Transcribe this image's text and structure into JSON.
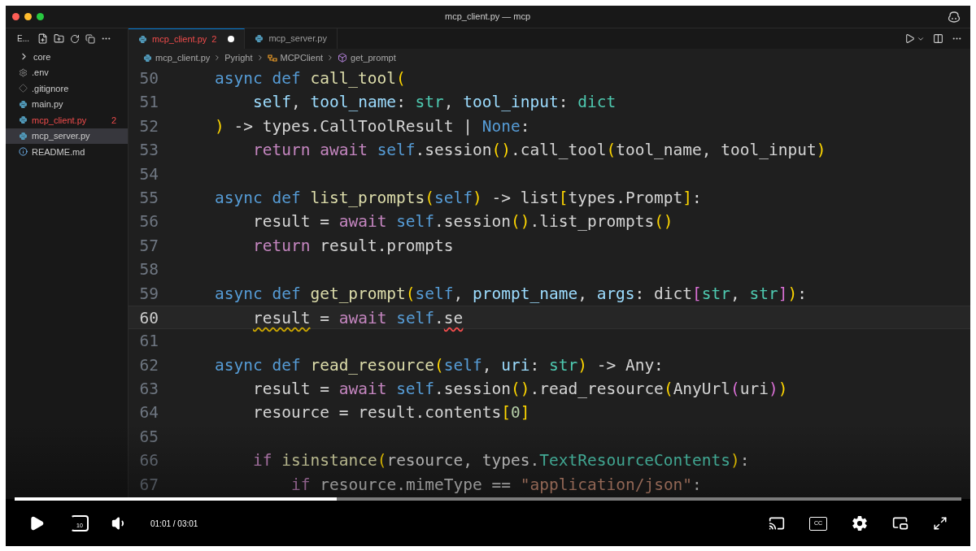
{
  "window": {
    "title": "mcp_client.py — mcp"
  },
  "sidebar": {
    "header": "E...",
    "items": [
      {
        "label": "core",
        "kind": "folder",
        "selected": false,
        "error": false
      },
      {
        "label": ".env",
        "kind": "settings",
        "selected": false,
        "error": false
      },
      {
        "label": ".gitignore",
        "kind": "git",
        "selected": false,
        "error": false
      },
      {
        "label": "main.py",
        "kind": "python",
        "selected": false,
        "error": false
      },
      {
        "label": "mcp_client.py",
        "kind": "python",
        "selected": false,
        "error": true,
        "problems": "2"
      },
      {
        "label": "mcp_server.py",
        "kind": "python",
        "selected": true,
        "error": false
      },
      {
        "label": "README.md",
        "kind": "info",
        "selected": false,
        "error": false
      }
    ]
  },
  "tabs": [
    {
      "label": "mcp_client.py",
      "problems": "2",
      "unsaved": true,
      "error": true,
      "selected": true
    },
    {
      "label": "mcp_server.py",
      "unsaved": false,
      "error": false,
      "selected": false
    }
  ],
  "breadcrumb": [
    {
      "label": "mcp_client.py",
      "kind": "python"
    },
    {
      "label": "Pyright",
      "kind": "plain"
    },
    {
      "label": "MCPClient",
      "kind": "class"
    },
    {
      "label": "get_prompt",
      "kind": "method"
    }
  ],
  "code": [
    {
      "number": "50",
      "current": false,
      "kind": "def",
      "tokens": [
        {
          "text": "async def ",
          "kind": "keyword"
        },
        {
          "text": "call_tool",
          "kind": "function"
        },
        {
          "text": "(",
          "kind": "bracket"
        }
      ]
    },
    {
      "number": "51",
      "current": false,
      "kind": "body",
      "tokens": [
        {
          "text": "self",
          "kind": "param"
        },
        {
          "text": ", ",
          "kind": "plain"
        },
        {
          "text": "tool_name",
          "kind": "param"
        },
        {
          "text": ": ",
          "kind": "plain"
        },
        {
          "text": "str",
          "kind": "type"
        },
        {
          "text": ", ",
          "kind": "plain"
        },
        {
          "text": "tool_input",
          "kind": "param"
        },
        {
          "text": ": ",
          "kind": "plain"
        },
        {
          "text": "dict",
          "kind": "type"
        }
      ]
    },
    {
      "number": "52",
      "current": false,
      "kind": "def",
      "tokens": [
        {
          "text": ")",
          "kind": "bracket"
        },
        {
          "text": " -> types.CallToolResult | ",
          "kind": "plain"
        },
        {
          "text": "None",
          "kind": "keyword"
        },
        {
          "text": ":",
          "kind": "plain"
        }
      ]
    },
    {
      "number": "53",
      "current": false,
      "kind": "body",
      "tokens": [
        {
          "text": "return await ",
          "kind": "control"
        },
        {
          "text": "self",
          "kind": "keyword"
        },
        {
          "text": ".session",
          "kind": "plain"
        },
        {
          "text": "()",
          "kind": "bracket"
        },
        {
          "text": ".call_tool",
          "kind": "plain"
        },
        {
          "text": "(",
          "kind": "bracket"
        },
        {
          "text": "tool_name, tool_input",
          "kind": "plain"
        },
        {
          "text": ")",
          "kind": "bracket"
        }
      ]
    },
    {
      "number": "54",
      "current": false
    },
    {
      "number": "55",
      "current": false,
      "kind": "def",
      "tokens": [
        {
          "text": "async def ",
          "kind": "keyword"
        },
        {
          "text": "list_prompts",
          "kind": "function"
        },
        {
          "text": "(",
          "kind": "bracket"
        },
        {
          "text": "self",
          "kind": "keyword"
        },
        {
          "text": ")",
          "kind": "bracket"
        },
        {
          "text": " -> list",
          "kind": "plain"
        },
        {
          "text": "[",
          "kind": "bracket"
        },
        {
          "text": "types.Prompt",
          "kind": "plain"
        },
        {
          "text": "]",
          "kind": "bracket"
        },
        {
          "text": ":",
          "kind": "plain"
        }
      ]
    },
    {
      "number": "56",
      "current": false,
      "kind": "body",
      "tokens": [
        {
          "text": "result = ",
          "kind": "plain"
        },
        {
          "text": "await ",
          "kind": "control"
        },
        {
          "text": "self",
          "kind": "keyword"
        },
        {
          "text": ".session",
          "kind": "plain"
        },
        {
          "text": "()",
          "kind": "bracket"
        },
        {
          "text": ".list_prompts",
          "kind": "plain"
        },
        {
          "text": "()",
          "kind": "bracket"
        }
      ]
    },
    {
      "number": "57",
      "current": false,
      "kind": "body",
      "tokens": [
        {
          "text": "return ",
          "kind": "control"
        },
        {
          "text": "result.prompts",
          "kind": "plain"
        }
      ]
    },
    {
      "number": "58",
      "current": false
    },
    {
      "number": "59",
      "current": false,
      "kind": "def",
      "tokens": [
        {
          "text": "async def ",
          "kind": "keyword"
        },
        {
          "text": "get_prompt",
          "kind": "function"
        },
        {
          "text": "(",
          "kind": "bracket"
        },
        {
          "text": "self",
          "kind": "keyword"
        },
        {
          "text": ", ",
          "kind": "plain"
        },
        {
          "text": "prompt_name",
          "kind": "param"
        },
        {
          "text": ", ",
          "kind": "plain"
        },
        {
          "text": "args",
          "kind": "param"
        },
        {
          "text": ": dict",
          "kind": "plain"
        },
        {
          "text": "[",
          "kind": "bracket2"
        },
        {
          "text": "str",
          "kind": "type"
        },
        {
          "text": ", ",
          "kind": "plain"
        },
        {
          "text": "str",
          "kind": "type"
        },
        {
          "text": "]",
          "kind": "bracket2"
        },
        {
          "text": ")",
          "kind": "bracket"
        },
        {
          "text": ":",
          "kind": "plain"
        }
      ]
    },
    {
      "number": "60",
      "current": true,
      "kind": "body",
      "tokens": [
        {
          "text": "result",
          "kind": "plain",
          "warning": true
        },
        {
          "text": " = ",
          "kind": "plain"
        },
        {
          "text": "await ",
          "kind": "control"
        },
        {
          "text": "self",
          "kind": "keyword"
        },
        {
          "text": ".",
          "kind": "plain"
        },
        {
          "text": "se",
          "kind": "plain",
          "error": true
        }
      ]
    },
    {
      "number": "61",
      "current": false
    },
    {
      "number": "62",
      "current": false,
      "kind": "def",
      "tokens": [
        {
          "text": "async def ",
          "kind": "keyword"
        },
        {
          "text": "read_resource",
          "kind": "function"
        },
        {
          "text": "(",
          "kind": "bracket"
        },
        {
          "text": "self",
          "kind": "keyword"
        },
        {
          "text": ", ",
          "kind": "plain"
        },
        {
          "text": "uri",
          "kind": "param"
        },
        {
          "text": ": ",
          "kind": "plain"
        },
        {
          "text": "str",
          "kind": "type"
        },
        {
          "text": ")",
          "kind": "bracket"
        },
        {
          "text": " -> Any:",
          "kind": "plain"
        }
      ]
    },
    {
      "number": "63",
      "current": false,
      "kind": "body",
      "tokens": [
        {
          "text": "result = ",
          "kind": "plain"
        },
        {
          "text": "await ",
          "kind": "control"
        },
        {
          "text": "self",
          "kind": "keyword"
        },
        {
          "text": ".session",
          "kind": "plain"
        },
        {
          "text": "()",
          "kind": "bracket"
        },
        {
          "text": ".read_resource",
          "kind": "plain"
        },
        {
          "text": "(",
          "kind": "bracket"
        },
        {
          "text": "AnyUrl",
          "kind": "plain"
        },
        {
          "text": "(",
          "kind": "bracket2"
        },
        {
          "text": "uri",
          "kind": "plain"
        },
        {
          "text": ")",
          "kind": "bracket2"
        },
        {
          "text": ")",
          "kind": "bracket"
        }
      ]
    },
    {
      "number": "64",
      "current": false,
      "kind": "body",
      "tokens": [
        {
          "text": "resource = result.contents",
          "kind": "plain"
        },
        {
          "text": "[",
          "kind": "bracket"
        },
        {
          "text": "0",
          "kind": "number"
        },
        {
          "text": "]",
          "kind": "bracket"
        }
      ]
    },
    {
      "number": "65",
      "current": false
    },
    {
      "number": "66",
      "current": false,
      "kind": "body",
      "tokens": [
        {
          "text": "if ",
          "kind": "control"
        },
        {
          "text": "isinstance",
          "kind": "function"
        },
        {
          "text": "(",
          "kind": "bracket"
        },
        {
          "text": "resource, types.",
          "kind": "plain"
        },
        {
          "text": "TextResourceContents",
          "kind": "type"
        },
        {
          "text": ")",
          "kind": "bracket"
        },
        {
          "text": ":",
          "kind": "plain"
        }
      ]
    },
    {
      "number": "67",
      "current": false,
      "kind": "inner",
      "tokens": [
        {
          "text": "if ",
          "kind": "control"
        },
        {
          "text": "resource.mimeType == ",
          "kind": "plain"
        },
        {
          "text": "\"application/json\"",
          "kind": "string"
        },
        {
          "text": ":",
          "kind": "plain"
        }
      ]
    }
  ],
  "player": {
    "level": 0.34,
    "rewind_label": "10",
    "time": "01:01 / 03:01",
    "captions_label": "CC"
  }
}
